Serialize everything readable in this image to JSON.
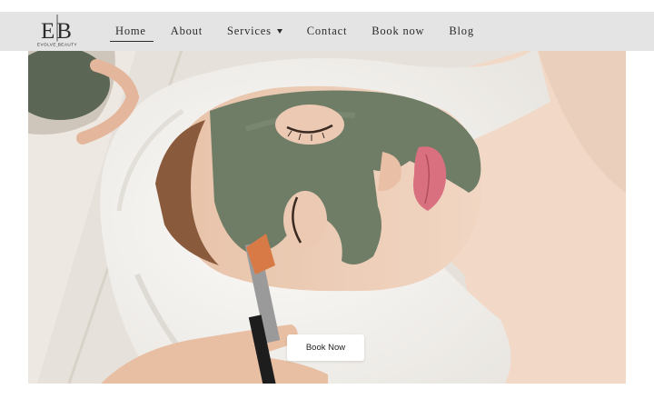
{
  "brand": {
    "logo_letters": "EB",
    "logo_subtitle": "EVOLVE BEAUTY"
  },
  "nav": {
    "items": [
      {
        "label": "Home",
        "active": true
      },
      {
        "label": "About"
      },
      {
        "label": "Services",
        "has_dropdown": true
      },
      {
        "label": "Contact"
      },
      {
        "label": "Book now"
      },
      {
        "label": "Blog"
      }
    ]
  },
  "hero": {
    "image_icon": "facial-mask-photo",
    "cta_label": "Book Now"
  },
  "colors": {
    "topbar": "#e4e4e4",
    "text": "#2b2b2b",
    "mask": "#6f7d67",
    "towel": "#f4f2ee",
    "skin": "#eccdb7"
  }
}
